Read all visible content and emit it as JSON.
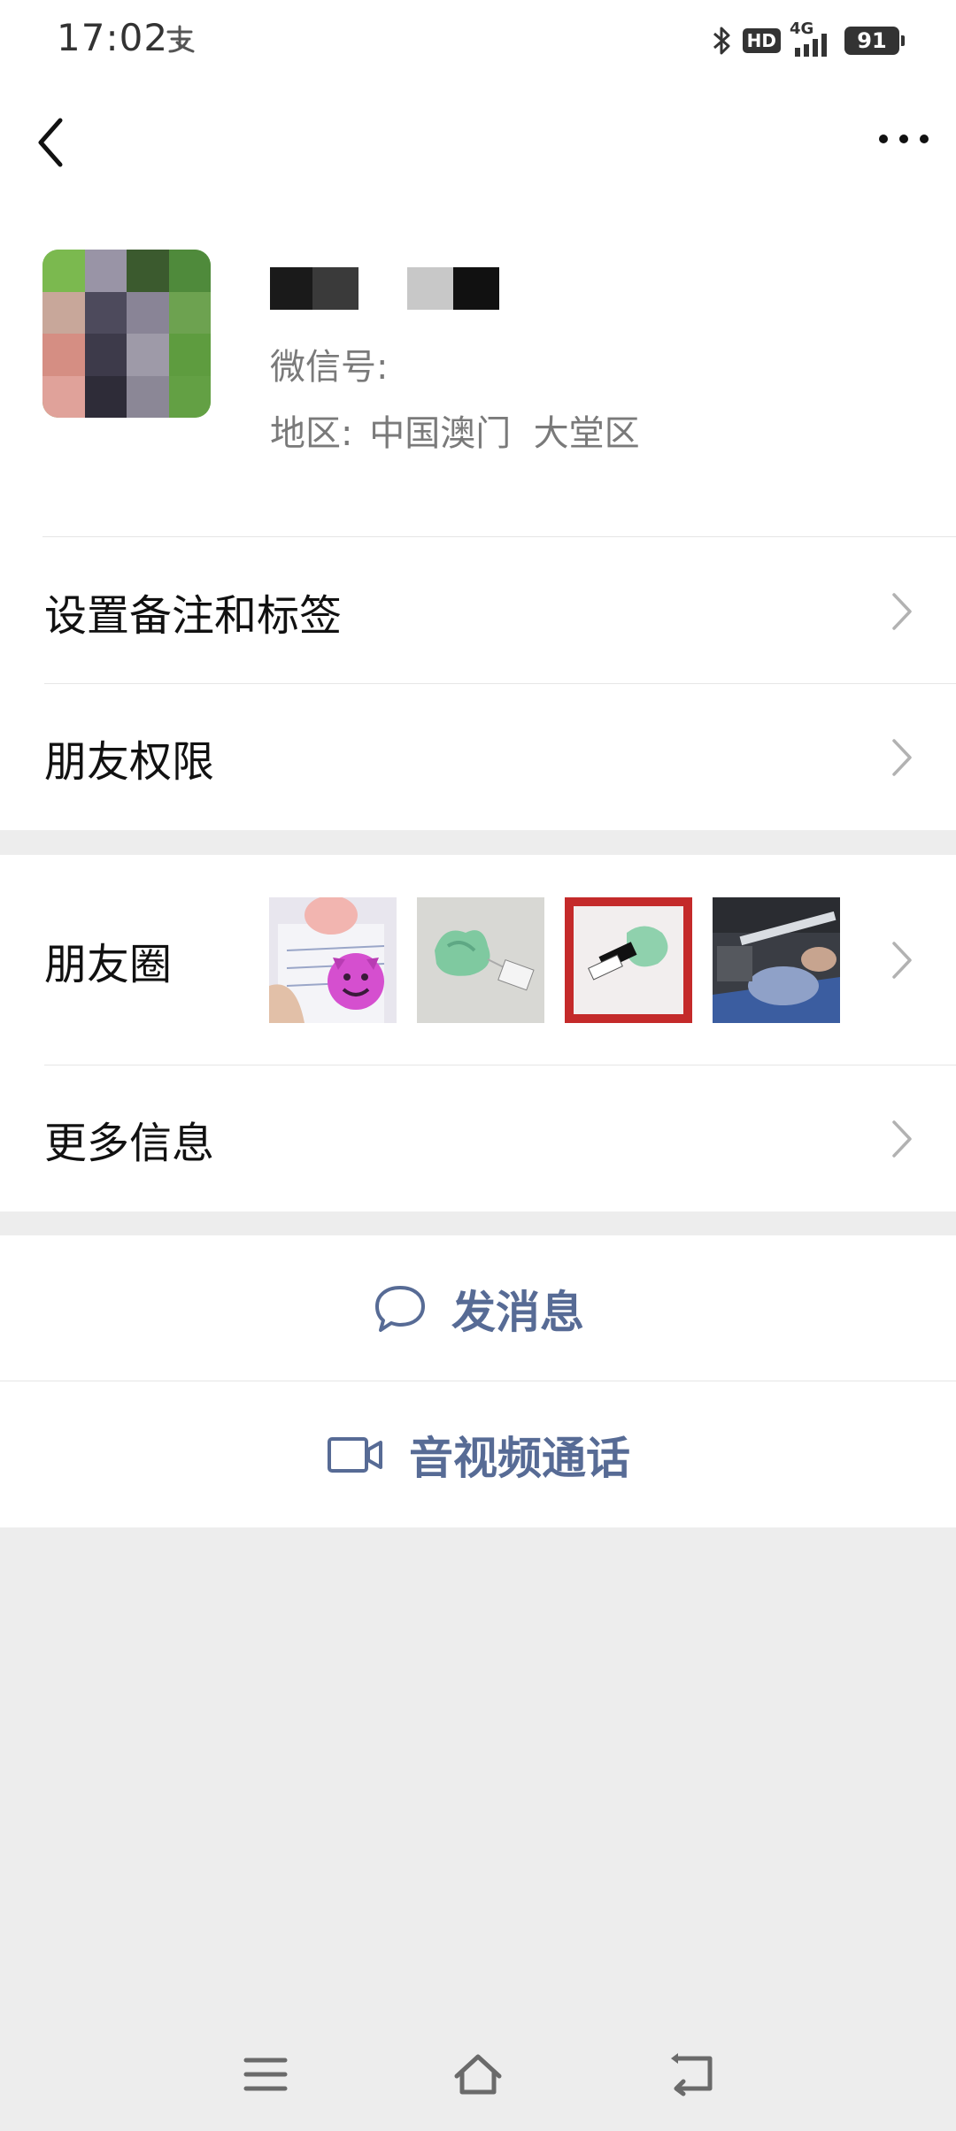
{
  "status_bar": {
    "time": "17:02",
    "alipay_icon": "alipay-icon",
    "bluetooth_icon": "bluetooth-icon",
    "hd_label": "HD",
    "network_label": "4G",
    "signal_icon": "signal-icon",
    "battery_level": "91"
  },
  "nav": {
    "back_icon": "back-arrow-icon",
    "more_icon": "more-dots-icon"
  },
  "profile": {
    "wechat_id_label": "微信号:",
    "region_label": "地区:",
    "region_value": "中国澳门  大堂区"
  },
  "menu": {
    "remark_label": "设置备注和标签",
    "permission_label": "朋友权限",
    "moments_label": "朋友圈",
    "more_info_label": "更多信息"
  },
  "actions": {
    "message_label": "发消息",
    "call_label": "音视频通话"
  },
  "colors": {
    "accent": "#576b95",
    "background": "#ededed",
    "surface": "#ffffff",
    "divider": "#e6e6e6"
  }
}
